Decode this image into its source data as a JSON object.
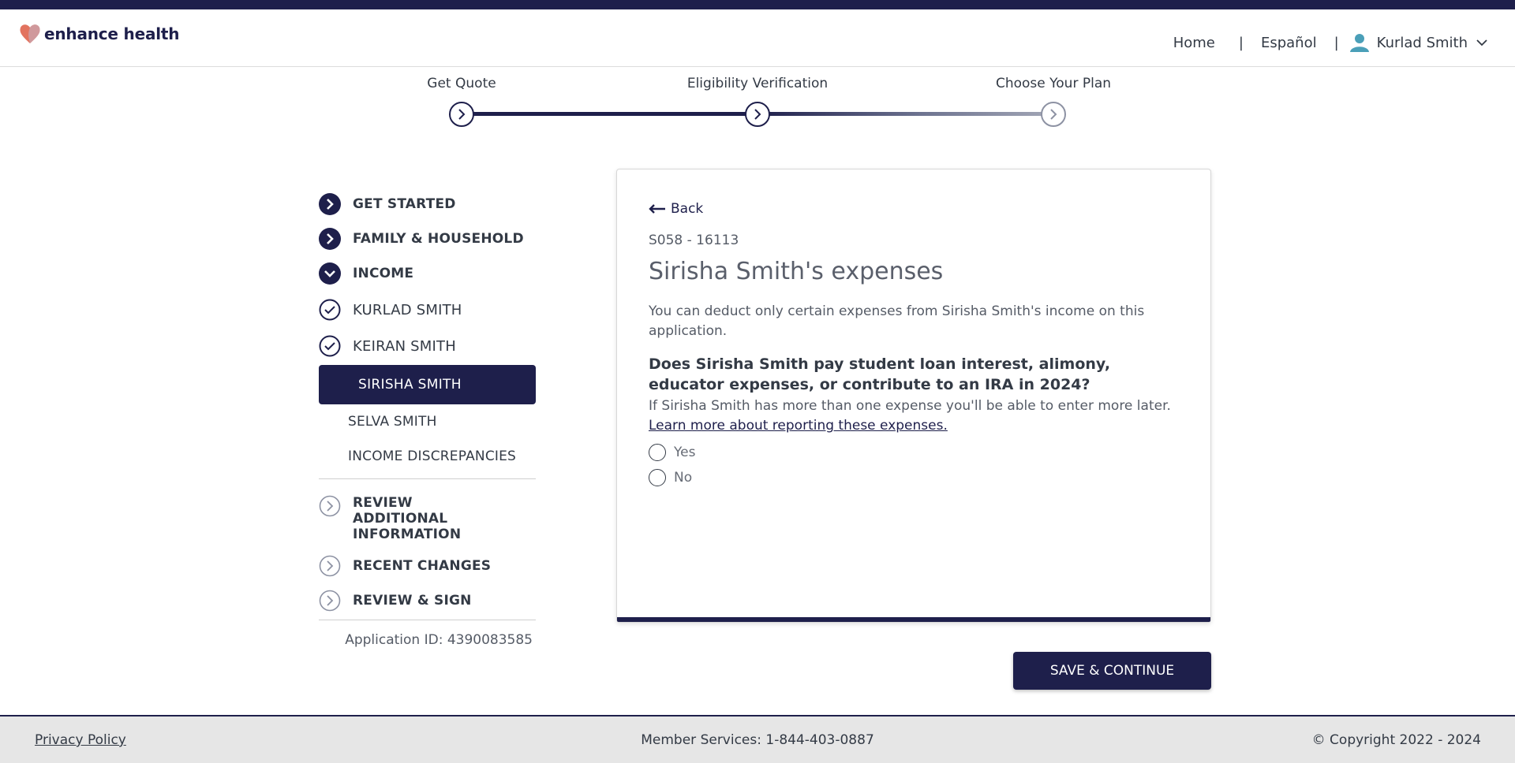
{
  "brand": {
    "name": "enhance health"
  },
  "nav": {
    "home": "Home",
    "language": "Español",
    "separator": "|",
    "user": "Kurlad Smith"
  },
  "progress": {
    "steps": [
      {
        "label": "Get Quote",
        "status": "complete"
      },
      {
        "label": "Eligibility Verification",
        "status": "current"
      },
      {
        "label": "Choose Your Plan",
        "status": "pending"
      }
    ]
  },
  "sidebar": {
    "sections": {
      "get_started": "GET STARTED",
      "family": "FAMILY & HOUSEHOLD",
      "income": "INCOME",
      "review_additional": "REVIEW ADDITIONAL INFORMATION",
      "recent_changes": "RECENT CHANGES",
      "review_sign": "REVIEW & SIGN"
    },
    "income_items": {
      "kurlad": "KURLAD SMITH",
      "keiran": "KEIRAN SMITH",
      "sirisha": "SIRISHA SMITH",
      "selva": "SELVA SMITH",
      "discrepancies": "INCOME DISCREPANCIES"
    },
    "application_id": "Application ID: 4390083585"
  },
  "card": {
    "back": "Back",
    "code": "S058 - 16113",
    "title": "Sirisha Smith's expenses",
    "description": "You can deduct only certain expenses from Sirisha Smith's income on this application.",
    "question": "Does Sirisha Smith pay student loan interest, alimony, educator expenses, or contribute to an IRA in 2024?",
    "hint": "If Sirisha Smith has more than one expense you'll be able to enter more later.",
    "learn_more": "Learn more about reporting these expenses.",
    "options": {
      "yes": "Yes",
      "no": "No"
    }
  },
  "actions": {
    "save_continue": "SAVE & CONTINUE"
  },
  "footer": {
    "privacy": "Privacy Policy",
    "member_services": "Member Services: 1-844-403-0887",
    "copyright": "© Copyright 2022 - 2024"
  },
  "colors": {
    "navy": "#1e1f4b",
    "logo_heart": "#e2735f",
    "avatar": "#4a9fb8"
  }
}
